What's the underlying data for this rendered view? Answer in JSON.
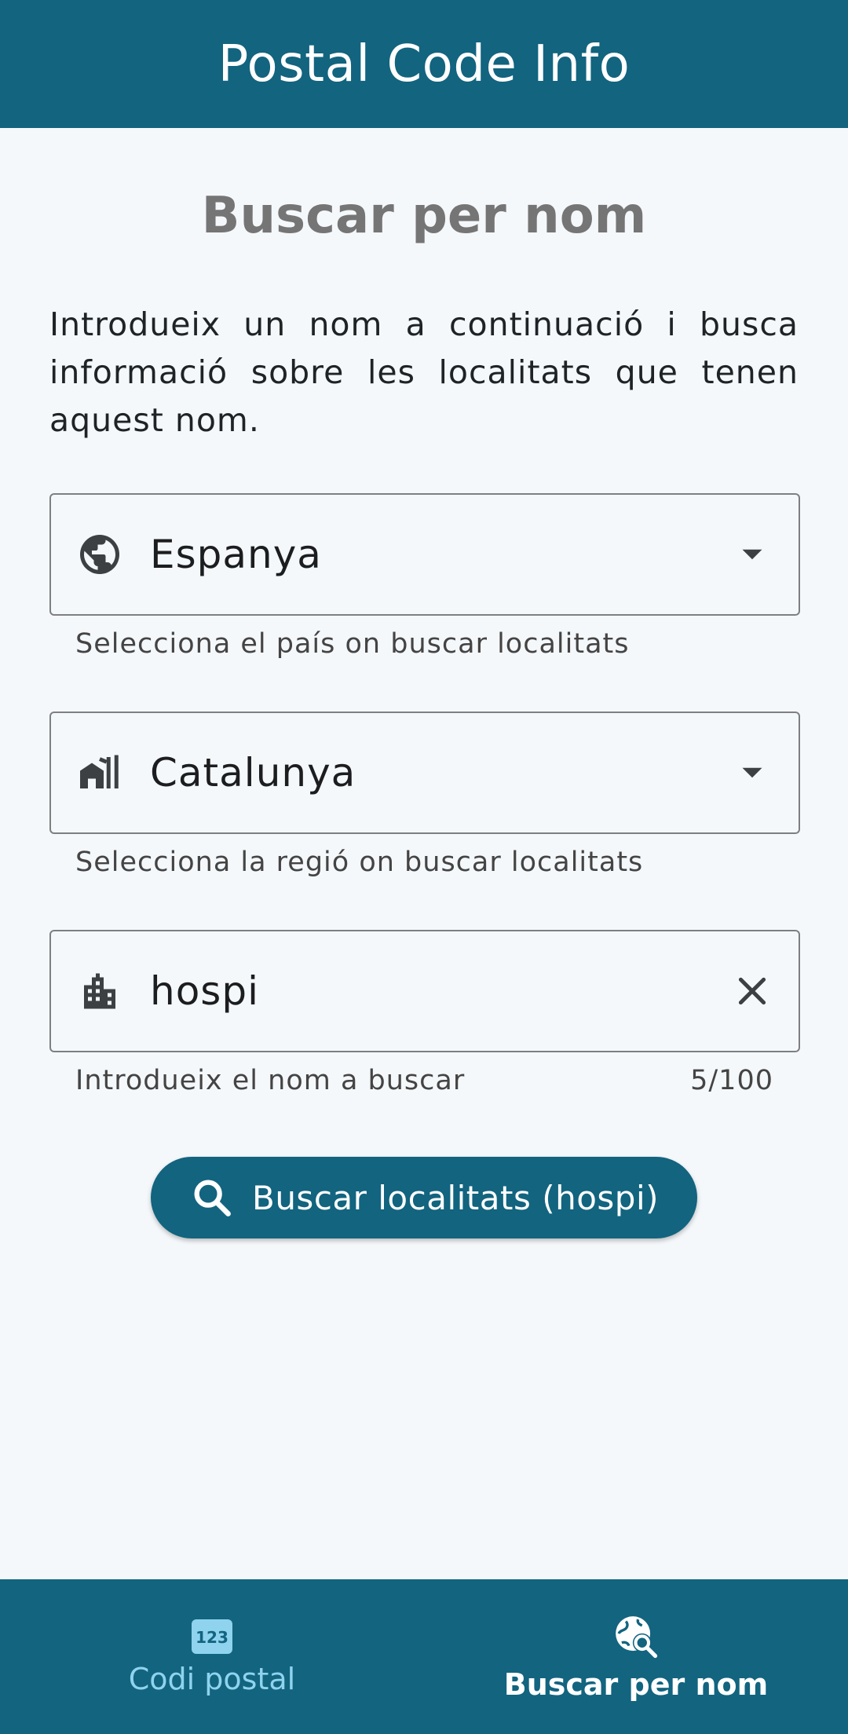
{
  "appbar": {
    "title": "Postal Code Info"
  },
  "page": {
    "heading": "Buscar per nom",
    "intro": "Introdueix un nom a continuació i busca informació sobre les localitats que tenen aquest nom."
  },
  "country_field": {
    "icon": "globe-icon",
    "value": "Espanya",
    "helper": "Selecciona el país on buscar localitats"
  },
  "region_field": {
    "icon": "region-buildings-icon",
    "value": "Catalunya",
    "helper": "Selecciona la regió on buscar localitats"
  },
  "name_field": {
    "icon": "city-icon",
    "value": "hospi",
    "helper": "Introdueix el nom a buscar",
    "counter": "5/100"
  },
  "search_button": {
    "label": "Buscar localitats (hospi)",
    "icon": "search-icon"
  },
  "bottom_nav": {
    "items": [
      {
        "label": "Codi postal",
        "icon": "numbers-123-icon",
        "active": false
      },
      {
        "label": "Buscar per nom",
        "icon": "globe-search-icon",
        "active": true
      }
    ]
  },
  "colors": {
    "primary": "#12647f",
    "background": "#f5f8fb",
    "nav_inactive": "#8fd3ee"
  }
}
